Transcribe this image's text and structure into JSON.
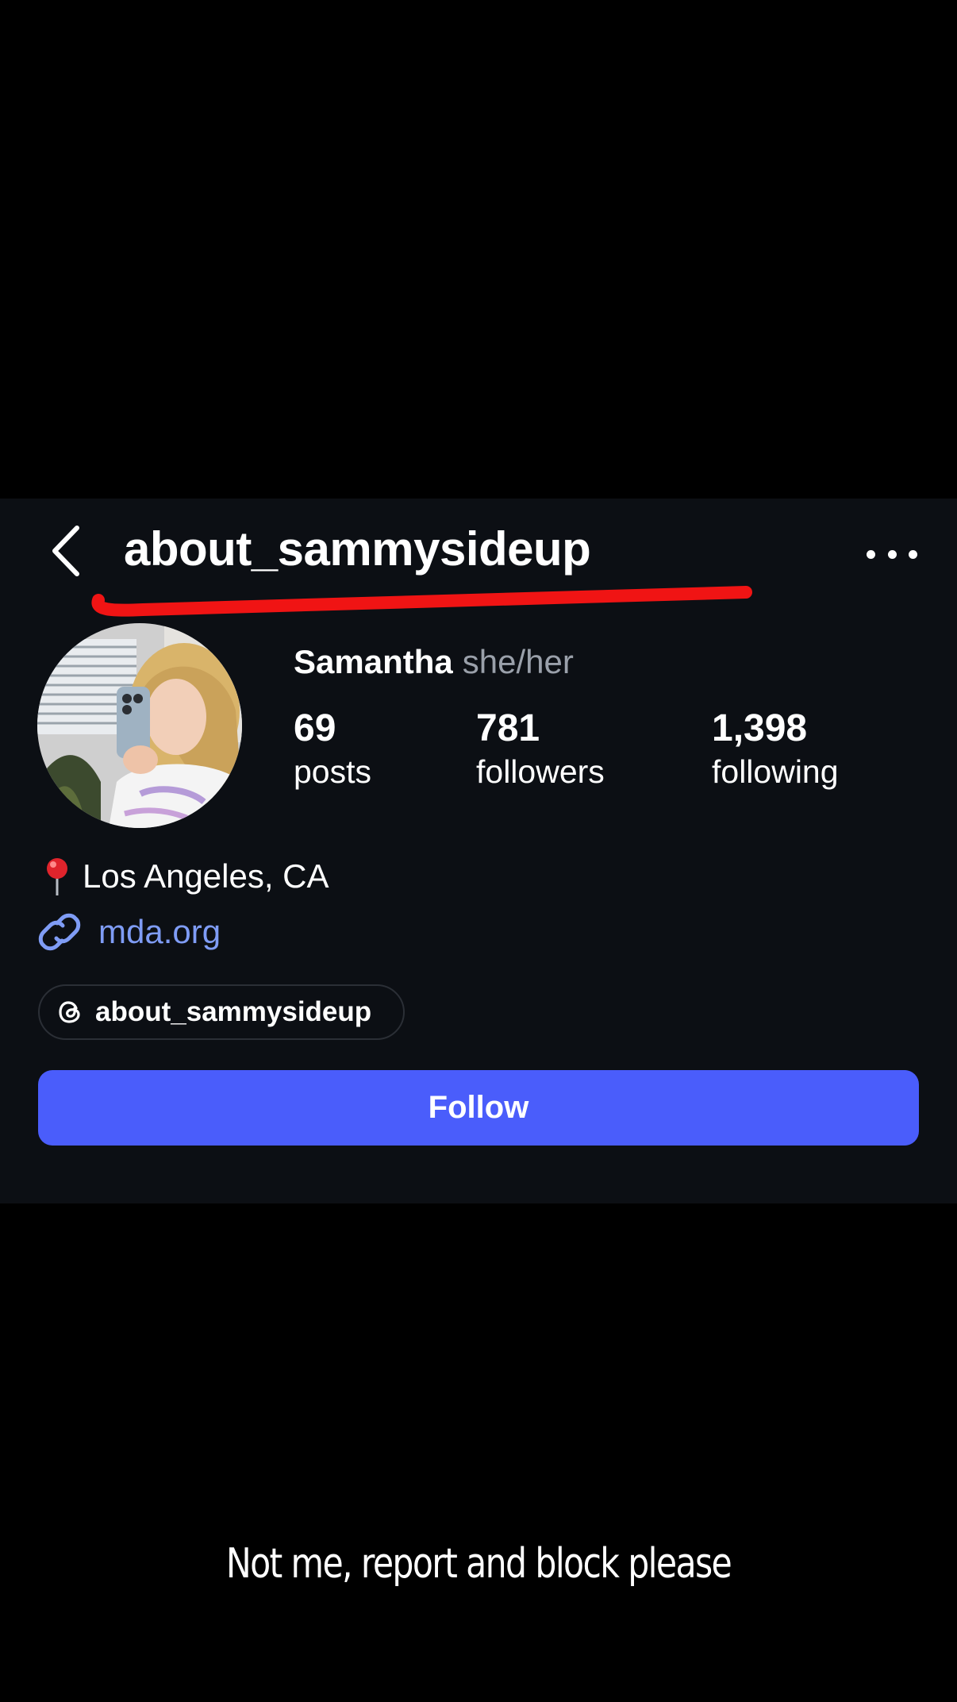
{
  "header": {
    "username": "about_sammysideup",
    "back_icon": "chevron-left-icon",
    "more_icon": "more-horizontal-icon"
  },
  "profile": {
    "display_name": "Samantha",
    "pronouns": "she/her",
    "stats": [
      {
        "value": "69",
        "label": "posts"
      },
      {
        "value": "781",
        "label": "followers"
      },
      {
        "value": "1,398",
        "label": "following"
      }
    ],
    "location": "Los Angeles, CA",
    "link": "mda.org",
    "threads_handle": "about_sammysideup"
  },
  "actions": {
    "follow_label": "Follow"
  },
  "caption": "Not me, report and block please",
  "colors": {
    "background": "#000000",
    "card": "#0c0f14",
    "accent_button": "#4a5dfb",
    "link": "#7f9cf5",
    "annotation_stroke": "#f01414",
    "secondary_text": "#9aa0aa"
  }
}
